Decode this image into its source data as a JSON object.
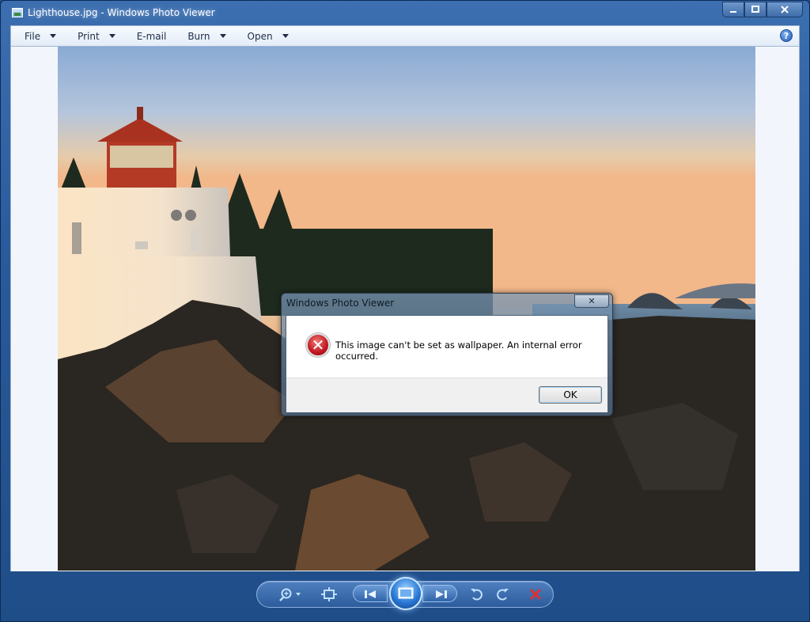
{
  "window": {
    "title": "Lighthouse.jpg - Windows Photo Viewer",
    "caption_buttons": {
      "minimize": "–",
      "maximize": "□",
      "close": "✕"
    }
  },
  "menubar": {
    "items": [
      {
        "label": "File",
        "has_dropdown": true
      },
      {
        "label": "Print",
        "has_dropdown": true
      },
      {
        "label": "E-mail",
        "has_dropdown": false
      },
      {
        "label": "Burn",
        "has_dropdown": true
      },
      {
        "label": "Open",
        "has_dropdown": true
      }
    ],
    "help_glyph": "?"
  },
  "photo": {
    "subject": "lighthouse on rocky coast at sunset"
  },
  "dialog": {
    "title": "Windows Photo Viewer",
    "close_glyph": "✕",
    "message": "This image can't be set as wallpaper. An internal error occurred.",
    "icon": "error-icon",
    "icon_glyph": "✕",
    "ok_label": "OK"
  },
  "controls": {
    "icons": [
      "zoom-icon",
      "actual-size-icon",
      "previous-icon",
      "slideshow-icon",
      "next-icon",
      "rotate-counterclockwise-icon",
      "rotate-clockwise-icon",
      "delete-icon"
    ]
  },
  "colors": {
    "frame": "#2a5a9b",
    "error_red": "#c1181f",
    "delete_red": "#e0312f"
  }
}
